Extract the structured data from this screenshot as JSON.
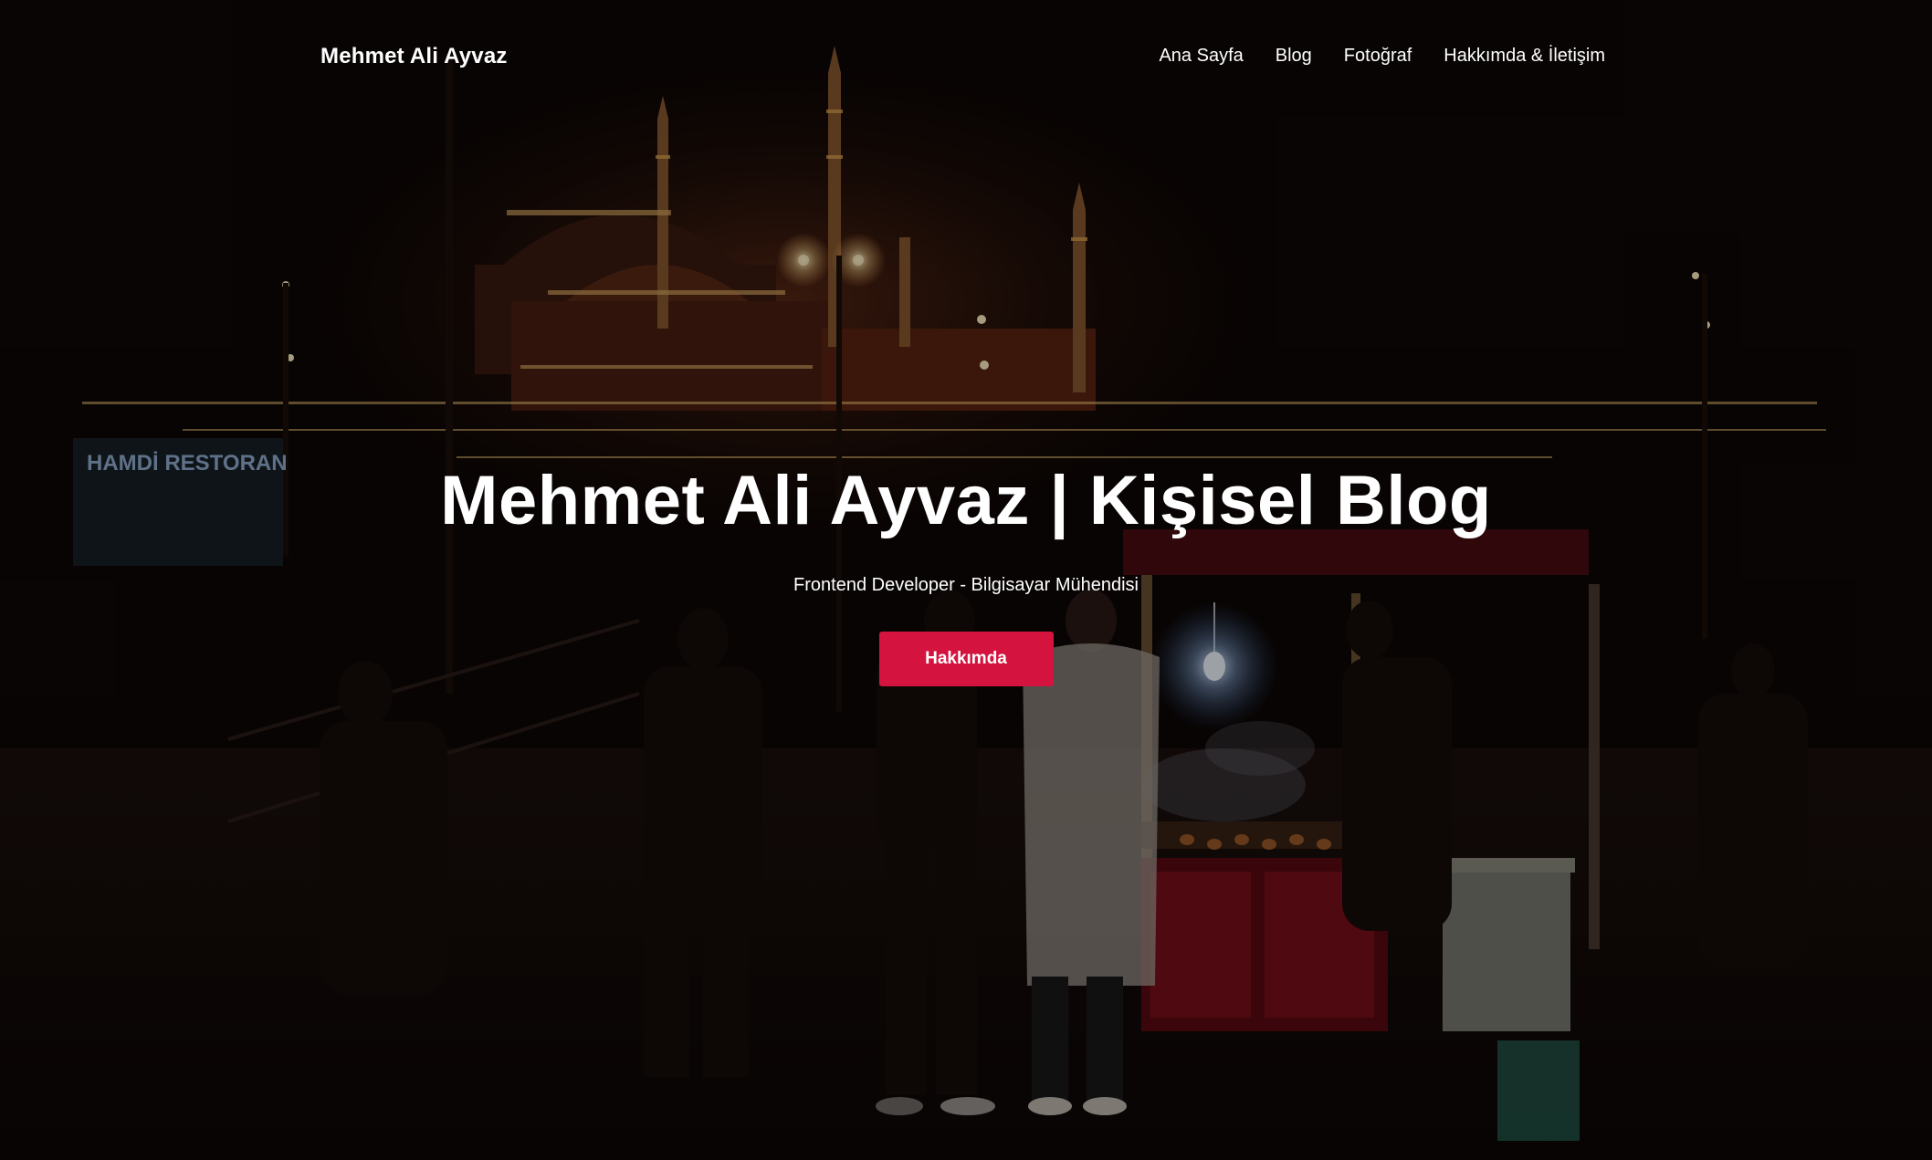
{
  "navbar": {
    "brand": "Mehmet Ali Ayvaz",
    "links": [
      {
        "label": "Ana Sayfa"
      },
      {
        "label": "Blog"
      },
      {
        "label": "Fotoğraf"
      },
      {
        "label": "Hakkımda & İletişim"
      }
    ]
  },
  "hero": {
    "title": "Mehmet Ali Ayvaz | Kişisel Blog",
    "subtitle": "Frontend Developer - Bilgisayar Mühendisi",
    "button_label": "Hakkımda",
    "background_sign": "HAMDİ RESTORAN"
  },
  "colors": {
    "accent": "#d4143f",
    "text": "#ffffff"
  }
}
